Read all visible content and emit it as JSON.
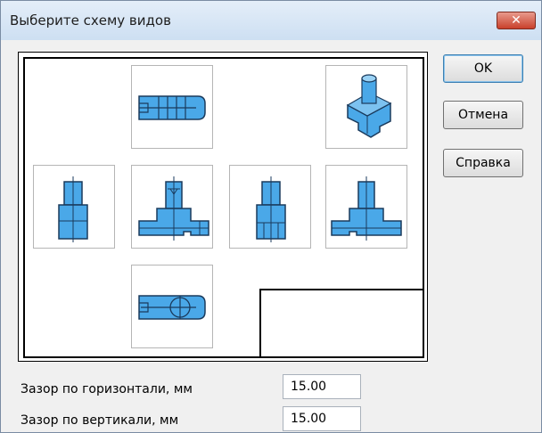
{
  "window": {
    "title": "Выберите схему видов",
    "close_label": "x"
  },
  "buttons": {
    "ok": "OK",
    "cancel": "Отмена",
    "help": "Справка"
  },
  "views": {
    "top": "view-top",
    "isometric": "view-isometric",
    "right": "view-right",
    "front": "view-front",
    "left": "view-left",
    "back": "view-back",
    "bottom": "view-bottom"
  },
  "fields": {
    "horizontal_gap": {
      "label": "Зазор по горизонтали, мм",
      "value": "15.00"
    },
    "vertical_gap": {
      "label": "Зазор по вертикали, мм",
      "value": "15.00"
    }
  },
  "colors": {
    "part_fill": "#4aa8e8",
    "part_stroke": "#1a3a5c",
    "titlebar": "#cddff2"
  }
}
